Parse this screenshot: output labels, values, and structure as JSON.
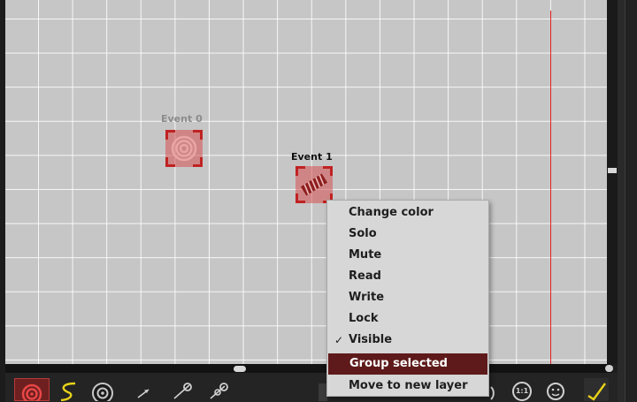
{
  "events": [
    {
      "label": "Event 0",
      "icon": "concentric-target-icon"
    },
    {
      "label": "Event 1",
      "icon": "striped-bar-icon"
    }
  ],
  "context_menu": {
    "items": [
      {
        "label": "Change color",
        "checked": false,
        "highlighted": false
      },
      {
        "label": "Solo",
        "checked": false,
        "highlighted": false
      },
      {
        "label": "Mute",
        "checked": false,
        "highlighted": false
      },
      {
        "label": "Read",
        "checked": false,
        "highlighted": false
      },
      {
        "label": "Write",
        "checked": false,
        "highlighted": false
      },
      {
        "label": "Lock",
        "checked": false,
        "highlighted": false
      },
      {
        "label": "Visible",
        "checked": true,
        "highlighted": false
      },
      {
        "label": "Group selected",
        "checked": false,
        "highlighted": true
      },
      {
        "label": "Move to new layer",
        "checked": false,
        "highlighted": false
      }
    ],
    "check_glyph": "✓"
  },
  "toolbar": {
    "tools": [
      {
        "name": "target-tool-icon",
        "active": true
      },
      {
        "name": "curve-tool-icon",
        "active": false
      },
      {
        "name": "speaker-tool-icon",
        "active": false
      },
      {
        "name": "arrow-tool-icon",
        "active": false
      },
      {
        "name": "node-link-tool-icon",
        "active": false
      },
      {
        "name": "node-link-double-tool-icon",
        "active": false
      }
    ],
    "zoom_reset_label": "1:1"
  },
  "colors": {
    "canvas": "#c6c6c6",
    "playhead": "#e02020",
    "event_fill": "#d75050",
    "event_corner": "#c02222",
    "menu_highlight": "#5e1a1a",
    "accent_yellow": "#e8d21a"
  }
}
